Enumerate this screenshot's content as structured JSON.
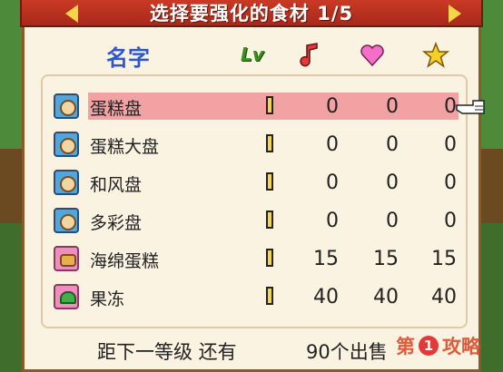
{
  "title": "选择要强化的食材 1/5",
  "headers": {
    "name": "名字",
    "lv": "Lv",
    "note_icon": "music-note-icon",
    "heart_icon": "heart-icon",
    "star_icon": "star-icon"
  },
  "rows": [
    {
      "name": "蛋糕盘",
      "icon": "plate-icon",
      "v1": "0",
      "v2": "0",
      "v3": "0"
    },
    {
      "name": "蛋糕大盘",
      "icon": "plate-icon",
      "v1": "0",
      "v2": "0",
      "v3": "0"
    },
    {
      "name": "和风盘",
      "icon": "plate-icon",
      "v1": "0",
      "v2": "0",
      "v3": "0"
    },
    {
      "name": "多彩盘",
      "icon": "plate-icon",
      "v1": "0",
      "v2": "0",
      "v3": "0"
    },
    {
      "name": "海绵蛋糕",
      "icon": "cake-icon",
      "v1": "15",
      "v2": "15",
      "v3": "15"
    },
    {
      "name": "果冻",
      "icon": "jelly-icon",
      "v1": "40",
      "v2": "40",
      "v3": "40"
    }
  ],
  "footer": {
    "line_a": "距下一等级 还有",
    "line_b": "90个出售"
  },
  "watermark": {
    "prefix": "第",
    "number": "1",
    "suffix": "攻略"
  },
  "colors": {
    "title_bar": "#c93a24",
    "selected_row": "#f2a2a2",
    "header_name": "#2f57c9",
    "panel": "#fbf3e2"
  }
}
